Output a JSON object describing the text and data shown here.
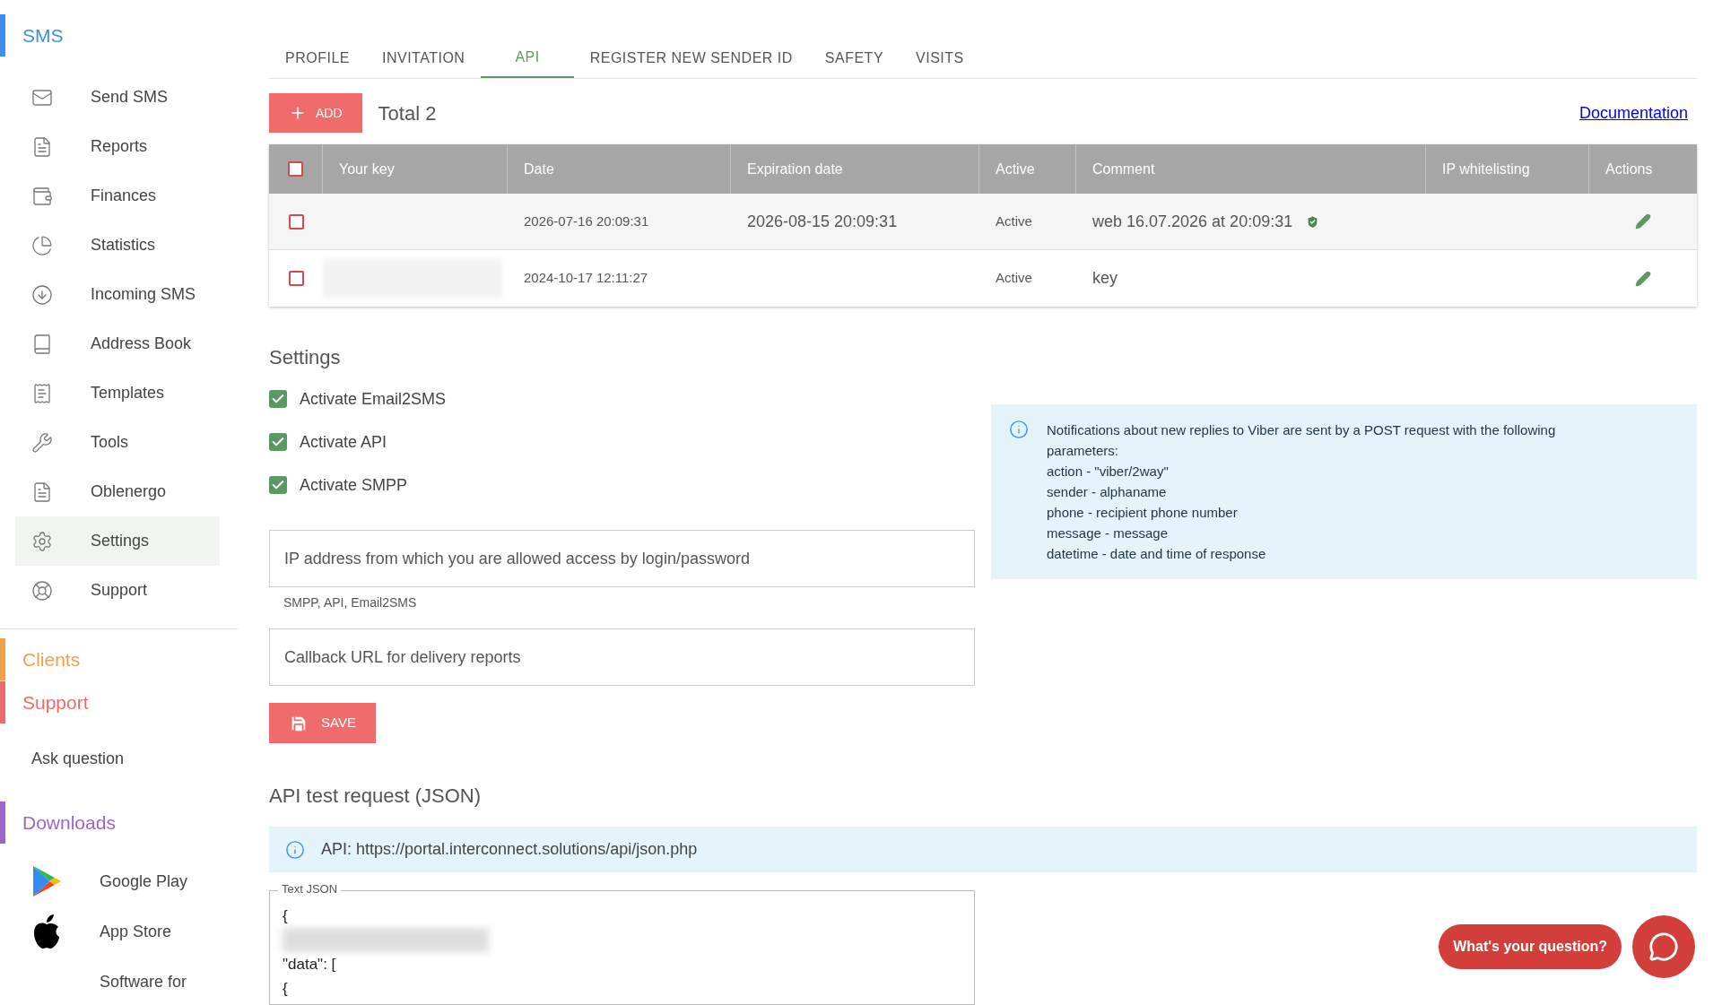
{
  "sidebar": {
    "sections": [
      {
        "title": "SMS",
        "color": "#3b8ef0",
        "items": [
          {
            "label": "Send SMS",
            "selected": false
          },
          {
            "label": "Reports",
            "selected": false
          },
          {
            "label": "Finances",
            "selected": false
          },
          {
            "label": "Statistics",
            "selected": false
          },
          {
            "label": "Incoming SMS",
            "selected": false
          },
          {
            "label": "Address Book",
            "selected": false
          },
          {
            "label": "Templates",
            "selected": false
          },
          {
            "label": "Tools",
            "selected": false
          },
          {
            "label": "Oblenergo",
            "selected": false
          },
          {
            "label": "Settings",
            "selected": true
          },
          {
            "label": "Support",
            "selected": false
          }
        ]
      },
      {
        "title": "Clients",
        "color": "#f0a04b"
      },
      {
        "title": "Support",
        "color": "#ee6b6b",
        "items": [
          {
            "label": "Ask question",
            "selected": false
          }
        ]
      },
      {
        "title": "Downloads",
        "color": "#9966cc",
        "items": [
          {
            "label": "Google Play",
            "selected": false
          },
          {
            "label": "App Store",
            "selected": false
          },
          {
            "label": "Software for",
            "selected": false
          }
        ]
      }
    ]
  },
  "tabs": [
    {
      "label": "PROFILE",
      "selected": false
    },
    {
      "label": "INVITATION",
      "selected": false
    },
    {
      "label": "API",
      "selected": true
    },
    {
      "label": "REGISTER NEW SENDER ID",
      "selected": false
    },
    {
      "label": "SAFETY",
      "selected": false
    },
    {
      "label": "VISITS",
      "selected": false
    }
  ],
  "toolbar": {
    "add_label": "ADD",
    "total": "Total 2",
    "link": "Documentation"
  },
  "table": {
    "header_checked": false,
    "columns": [
      "Your key",
      "Date",
      "Expiration date",
      "Active",
      "Comment",
      "IP whitelisting",
      "Actions"
    ],
    "rows": [
      {
        "checked": false,
        "key_blurred": false,
        "date": "2026-07-16 20:09:31",
        "expiration": "2026-08-15 20:09:31",
        "active": "Active",
        "comment": "web 16.07.2026 at 20:09:31",
        "verified": true
      },
      {
        "checked": false,
        "key_blurred": true,
        "date": "2024-10-17 12:11:27",
        "active": "Active",
        "comment": "key",
        "verified": false
      }
    ]
  },
  "settings": {
    "title": "Settings",
    "options": [
      {
        "label": "Activate Email2SMS",
        "checked": true
      },
      {
        "label": "Activate API",
        "checked": true
      },
      {
        "label": "Activate SMPP",
        "checked": true
      }
    ],
    "ip_field": {
      "placeholder": "IP address from which you are allowed access by login/password",
      "helper": "SMPP, API, Email2SMS"
    },
    "callback_field": {
      "placeholder": "Callback URL for delivery reports"
    },
    "save_label": "SAVE",
    "info": [
      "Notifications about new replies to Viber are sent by a POST request with the following parameters:",
      "action - \"viber/2way\"",
      "sender - alphaname",
      "phone - recipient phone number",
      "message - message",
      "datetime - date and time of response"
    ]
  },
  "api_test": {
    "title": "API test request (JSON)",
    "info": "API: https://portal.interconnect.solutions/api/json.php",
    "textarea_label": "Text JSON",
    "lines": [
      {
        "kind": "text",
        "text": "{"
      },
      {
        "kind": "blurred"
      },
      {
        "kind": "text",
        "text": "\"data\": ["
      },
      {
        "kind": "text",
        "text": "{"
      }
    ]
  },
  "chat": {
    "label": "What's your question?"
  }
}
